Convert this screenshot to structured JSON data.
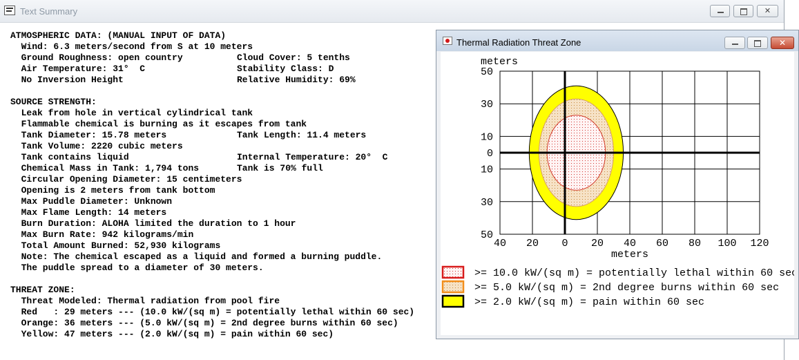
{
  "main_window": {
    "title": "Text Summary",
    "buttons": {
      "minimize": "minimize",
      "maximize": "maximize",
      "close": "close"
    },
    "close_glyph": "✕"
  },
  "summary": {
    "rows": [
      {
        "c1": "ATMOSPHERIC DATA: (MANUAL INPUT OF DATA)",
        "c2": ""
      },
      {
        "c1": "  Wind: 6.3 meters/second from S at 10 meters",
        "c2": ""
      },
      {
        "c1": "  Ground Roughness: open country",
        "c2": "Cloud Cover: 5 tenths"
      },
      {
        "c1": "  Air Temperature: 31°  C",
        "c2": "Stability Class: D"
      },
      {
        "c1": "  No Inversion Height",
        "c2": "Relative Humidity: 69%"
      },
      {
        "c1": "",
        "c2": ""
      },
      {
        "c1": "SOURCE STRENGTH:",
        "c2": ""
      },
      {
        "c1": "  Leak from hole in vertical cylindrical tank",
        "c2": ""
      },
      {
        "c1": "  Flammable chemical is burning as it escapes from tank",
        "c2": ""
      },
      {
        "c1": "  Tank Diameter: 15.78 meters",
        "c2": "Tank Length: 11.4 meters"
      },
      {
        "c1": "  Tank Volume: 2220 cubic meters",
        "c2": ""
      },
      {
        "c1": "  Tank contains liquid",
        "c2": "Internal Temperature: 20°  C"
      },
      {
        "c1": "  Chemical Mass in Tank: 1,794 tons",
        "c2": "Tank is 70% full"
      },
      {
        "c1": "  Circular Opening Diameter: 15 centimeters",
        "c2": ""
      },
      {
        "c1": "  Opening is 2 meters from tank bottom",
        "c2": ""
      },
      {
        "c1": "  Max Puddle Diameter: Unknown",
        "c2": ""
      },
      {
        "c1": "  Max Flame Length: 14 meters",
        "c2": ""
      },
      {
        "c1": "  Burn Duration: ALOHA limited the duration to 1 hour",
        "c2": ""
      },
      {
        "c1": "  Max Burn Rate: 942 kilograms/min",
        "c2": ""
      },
      {
        "c1": "  Total Amount Burned: 52,930 kilograms",
        "c2": ""
      },
      {
        "c1": "  Note: The chemical escaped as a liquid and formed a burning puddle.",
        "c2": ""
      },
      {
        "c1": "  The puddle spread to a diameter of 30 meters.",
        "c2": ""
      },
      {
        "c1": "",
        "c2": ""
      },
      {
        "c1": "THREAT ZONE:",
        "c2": ""
      },
      {
        "c1": "  Threat Modeled: Thermal radiation from pool fire",
        "c2": ""
      },
      {
        "c1": "  Red   : 29 meters --- (10.0 kW/(sq m) = potentially lethal within 60 sec)",
        "c2": ""
      },
      {
        "c1": "  Orange: 36 meters --- (5.0 kW/(sq m) = 2nd degree burns within 60 sec)",
        "c2": ""
      },
      {
        "c1": "  Yellow: 47 meters --- (2.0 kW/(sq m) = pain within 60 sec)",
        "c2": ""
      }
    ]
  },
  "threat_window": {
    "title": "Thermal Radiation Threat Zone",
    "close_glyph": "✕",
    "icon": "aloha-app-icon"
  },
  "chart_data": {
    "type": "threat-zone-plot",
    "ylabel_top": "meters",
    "xlabel": "meters",
    "x_ticks": [
      "40",
      "20",
      "0",
      "20",
      "40",
      "60",
      "80",
      "100",
      "120"
    ],
    "x_tick_values": [
      -40,
      -20,
      0,
      20,
      40,
      60,
      80,
      100,
      120
    ],
    "y_ticks": [
      "50",
      "30",
      "10",
      "0",
      "10",
      "30",
      "50"
    ],
    "y_tick_values": [
      50,
      30,
      10,
      0,
      -10,
      -30,
      -50
    ],
    "xlim": [
      -40,
      120
    ],
    "ylim": [
      -50,
      50
    ],
    "grid": true,
    "zones": [
      {
        "color": "#ffff00",
        "stroke": "#000000",
        "cx": 7,
        "cy": 0,
        "rx": 29,
        "ry": 41,
        "pattern": "solid"
      },
      {
        "color": "#f6e2c6",
        "stroke": "#d8a060",
        "cx": 7,
        "cy": 0,
        "rx": 23,
        "ry": 33,
        "pattern": "dotted"
      },
      {
        "color": "#fff2f2",
        "stroke": "#d23b2b",
        "cx": 7,
        "cy": 0,
        "rx": 18,
        "ry": 23,
        "pattern": "dotted-red"
      }
    ],
    "legend": [
      {
        "swatch": "#ffeef0",
        "border": "#d81b1b",
        "text": ">= 10.0 kW/(sq m) = potentially lethal within 60 sec"
      },
      {
        "swatch": "#f6e2c6",
        "border": "#f28e1c",
        "text": ">= 5.0 kW/(sq m) = 2nd degree burns within 60 sec"
      },
      {
        "swatch": "#ffff00",
        "border": "#000000",
        "text": ">= 2.0 kW/(sq m) = pain within 60 sec"
      }
    ]
  }
}
